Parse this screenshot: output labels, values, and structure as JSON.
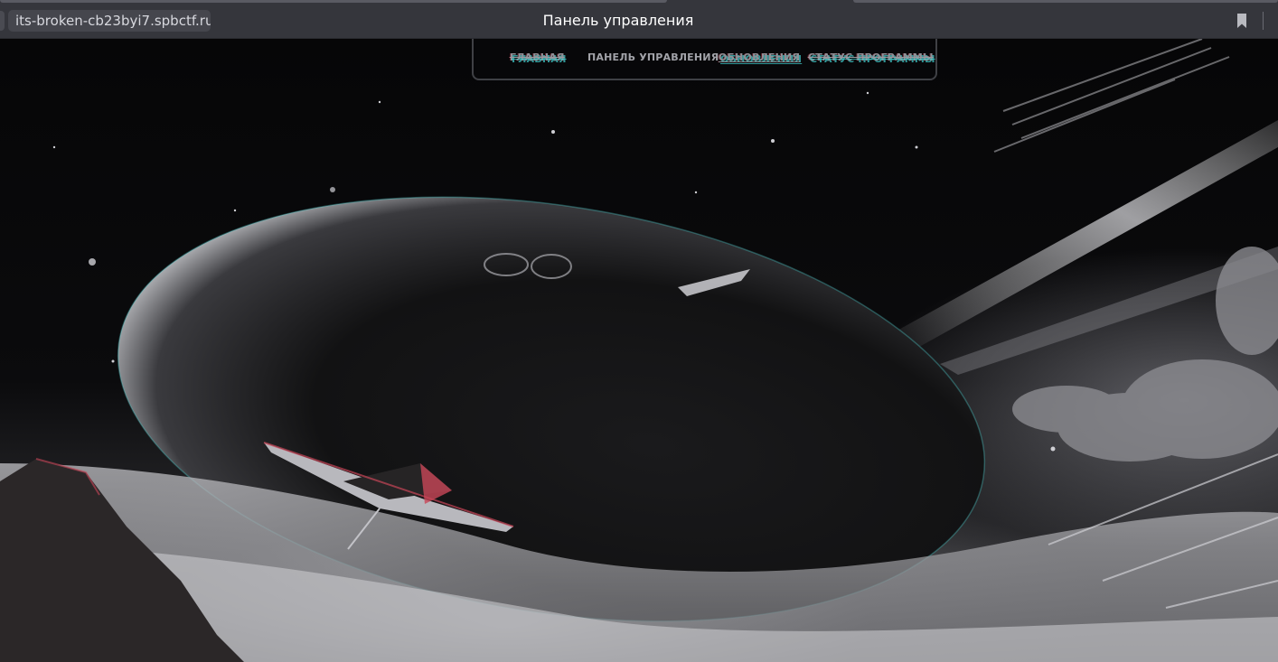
{
  "browser": {
    "url": "its-broken-cb23byi7.spbctf.ru",
    "window_title": "Панель управления",
    "bookmark_icon": "bookmark-icon"
  },
  "nav": {
    "items": [
      {
        "label": "ГЛАВНАЯ",
        "style": "glitch-struck"
      },
      {
        "label": "ПАНЕЛЬ УПРАВЛЕНИЯ",
        "style": "plain"
      },
      {
        "label": "ОБНОВЛЕНИЯ",
        "style": "glitch-underlined"
      },
      {
        "label": "СТАТУС ПРОГРАММЫ",
        "style": "glitch-struck"
      }
    ]
  },
  "background": {
    "subject": "space-scene",
    "colors": {
      "sky": "#060607",
      "planet": "#151516",
      "fog": "#d8d8dc",
      "glitch_cyan": "#40c8c8",
      "glitch_red": "#c84658"
    }
  }
}
